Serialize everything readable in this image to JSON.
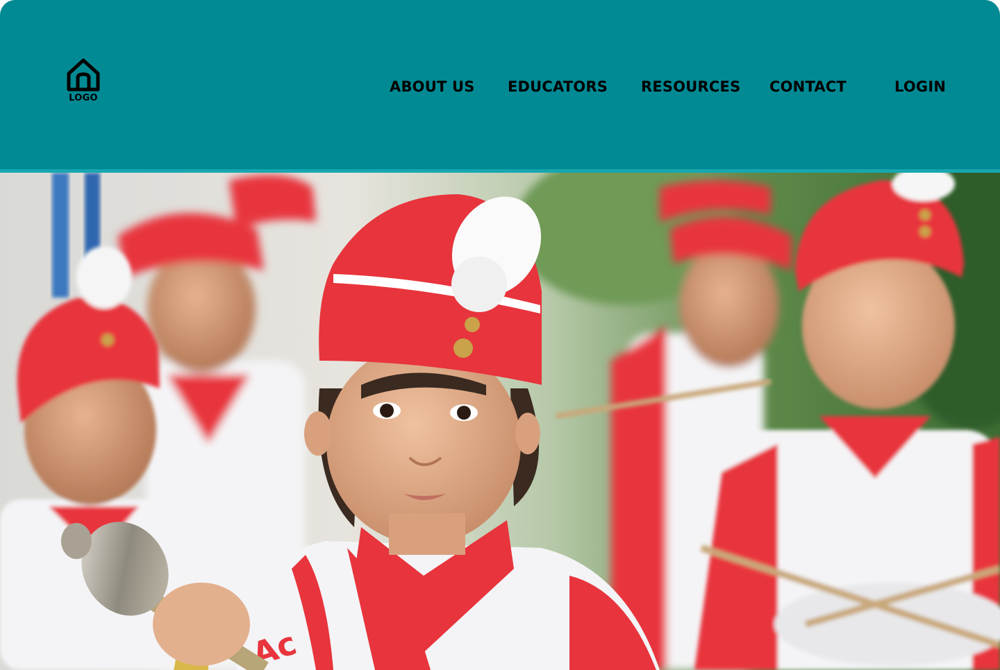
{
  "header": {
    "logo_label": "LOGO",
    "nav": [
      {
        "label": "ABOUT US"
      },
      {
        "label": "EDUCATORS"
      },
      {
        "label": "RESOURCES"
      },
      {
        "label": "CONTACT"
      },
      {
        "label": "LOGIN"
      }
    ]
  },
  "hero": {
    "image_subject": "children in red and white marching band uniforms with drums",
    "sash_text": "Ac"
  },
  "colors": {
    "header_bg": "#028a94",
    "header_rule": "#17a7b0",
    "nav_text": "#000000",
    "uniform_red": "#e8343c",
    "uniform_white": "#f4f4f6"
  }
}
